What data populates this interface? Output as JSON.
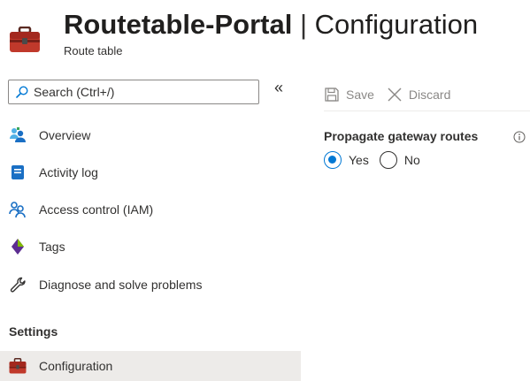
{
  "header": {
    "title": "Routetable-Portal",
    "separator": "|",
    "section": "Configuration",
    "subtitle": "Route table",
    "icon": "route-table-icon"
  },
  "sidebar": {
    "search_placeholder": "Search (Ctrl+/)",
    "collapse_glyph": "«",
    "items": [
      {
        "label": "Overview",
        "icon": "overview-icon"
      },
      {
        "label": "Activity log",
        "icon": "activity-log-icon"
      },
      {
        "label": "Access control (IAM)",
        "icon": "access-control-icon"
      },
      {
        "label": "Tags",
        "icon": "tag-icon"
      },
      {
        "label": "Diagnose and solve problems",
        "icon": "wrench-icon"
      }
    ],
    "section_settings": "Settings",
    "settings_items": [
      {
        "label": "Configuration",
        "icon": "route-table-icon",
        "active": true
      }
    ]
  },
  "toolbar": {
    "save_label": "Save",
    "discard_label": "Discard"
  },
  "main": {
    "propagate_label": "Propagate gateway routes",
    "options": [
      {
        "label": "Yes",
        "selected": true
      },
      {
        "label": "No",
        "selected": false
      }
    ]
  },
  "colors": {
    "accent": "#0078d4",
    "active_bg": "#edebe9",
    "disabled_text": "#8a8886",
    "route_icon_red": "#b52e26"
  }
}
